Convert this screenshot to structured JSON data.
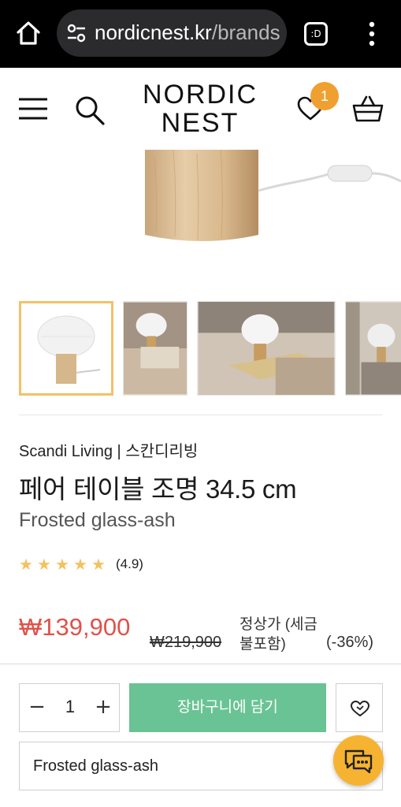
{
  "browser": {
    "url_host": "nordicnest.kr",
    "url_path": "/brands",
    "tab_count": ":D"
  },
  "header": {
    "logo_line1": "NORDIC",
    "logo_line2": "NEST",
    "wishlist_count": "1"
  },
  "product": {
    "brand": "Scandi Living | 스칸디리빙",
    "title": "페어 테이블 조명 34.5 cm",
    "variant": "Frosted glass-ash",
    "rating": 5,
    "rating_max": 5,
    "rating_score": "(4.9)",
    "price": "₩139,900",
    "old_price": "₩219,900",
    "regular_label": "정상가 (세금불포함)",
    "discount": "(-36%)"
  },
  "thumbnails": [
    {
      "name": "thumb-1",
      "selected": true
    },
    {
      "name": "thumb-2",
      "selected": false
    },
    {
      "name": "thumb-3",
      "selected": false
    },
    {
      "name": "thumb-4",
      "selected": false
    }
  ],
  "purchase": {
    "quantity": "1",
    "minus": "−",
    "plus": "+",
    "add_to_cart_label": "장바구니에 담기",
    "variant_selected": "Frosted glass-ash"
  },
  "icons": {
    "home": "home-icon",
    "tune": "site-settings-icon",
    "tabs": "tabs-icon",
    "more": "more-vert-icon",
    "menu": "menu-icon",
    "search": "search-icon",
    "wishlist": "heart-icon",
    "basket": "basket-icon",
    "heart_add": "heart-plus-icon",
    "chat": "chat-icon",
    "star": "star-icon"
  },
  "colors": {
    "accent_sale": "#e0524a",
    "cart_button": "#6ac394",
    "badge": "#f0a030",
    "star": "#f3c15f",
    "chat": "#f6b332"
  }
}
